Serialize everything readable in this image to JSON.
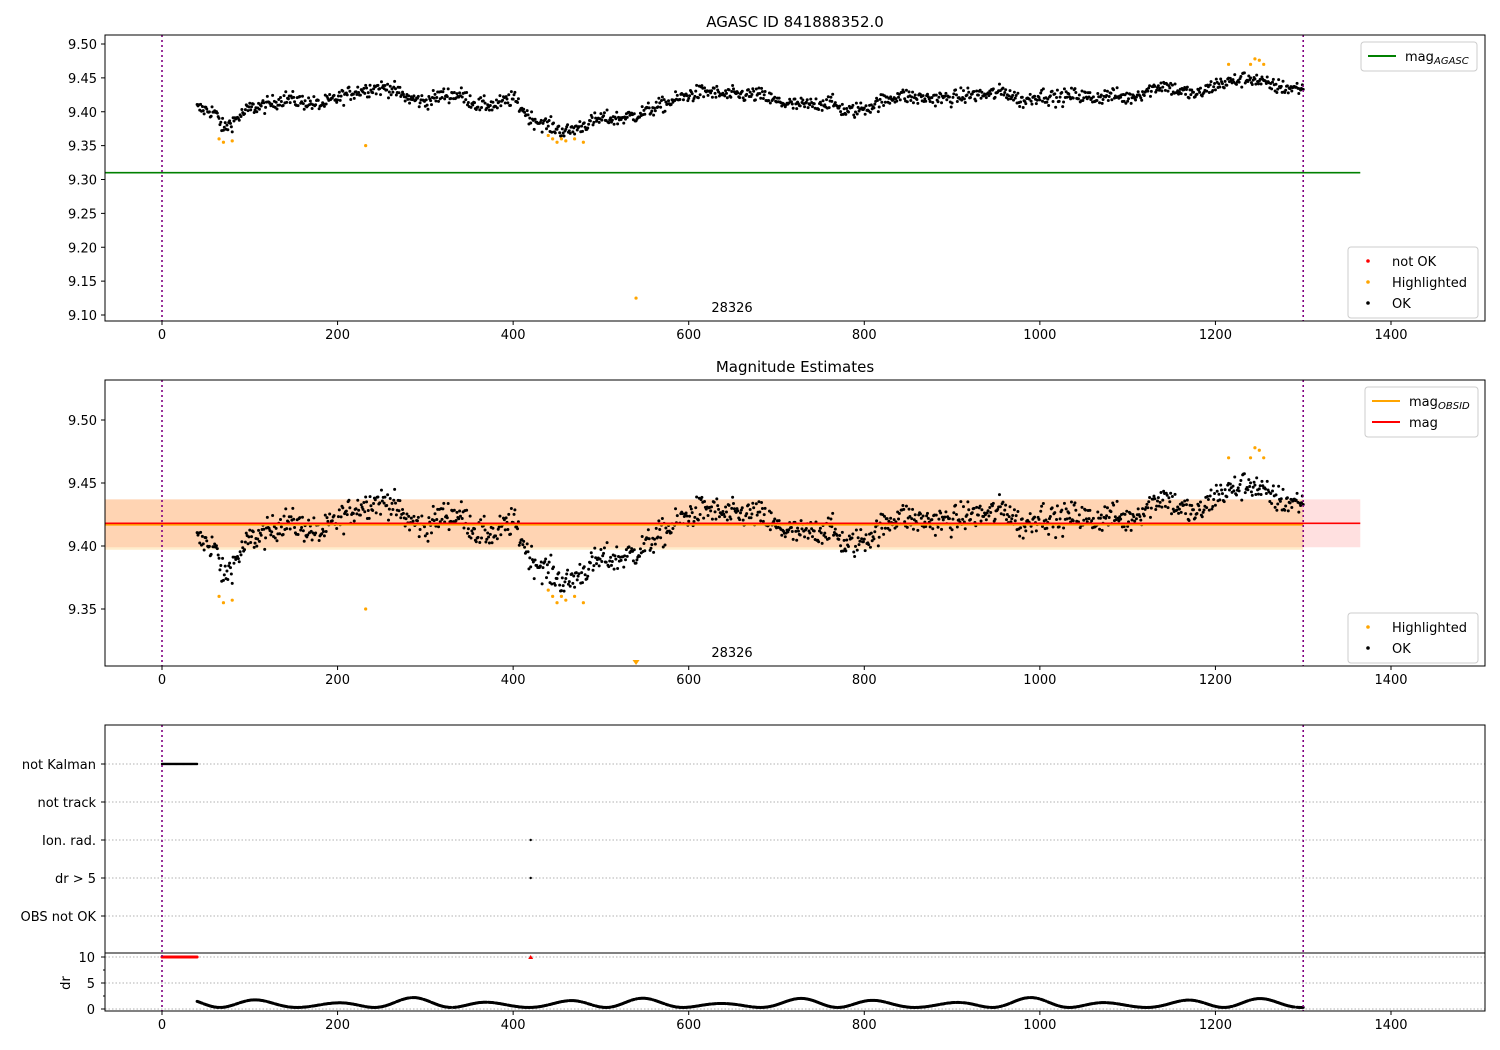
{
  "chart_data": [
    {
      "type": "scatter",
      "title": "AGASC ID 841888352.0",
      "xlim": [
        -65,
        1505
      ],
      "ylim": [
        9.092,
        9.51
      ],
      "xticks": [
        "0",
        "200",
        "400",
        "600",
        "800",
        "1000",
        "1200",
        "1400"
      ],
      "yticks": [
        "9.10",
        "9.15",
        "9.20",
        "9.25",
        "9.30",
        "9.35",
        "9.40",
        "9.45",
        "9.50"
      ],
      "annotation": "28326",
      "vlines": [
        0,
        1300
      ],
      "hline": {
        "name": "mag_AGASC",
        "value": 9.31,
        "color": "#008000",
        "xmax": 1365
      },
      "legend_top": [
        {
          "label": "mag",
          "sub": "AGASC",
          "color": "#008000"
        }
      ],
      "legend_bottom": [
        {
          "label": "not OK",
          "color": "#ff0000"
        },
        {
          "label": "Highlighted",
          "color": "#ffa500"
        },
        {
          "label": "OK",
          "color": "#000000"
        }
      ]
    },
    {
      "type": "scatter",
      "title": "Magnitude Estimates",
      "xlim": [
        -65,
        1505
      ],
      "ylim": [
        9.305,
        9.535
      ],
      "xticks": [
        "0",
        "200",
        "400",
        "600",
        "800",
        "1000",
        "1200",
        "1400"
      ],
      "yticks": [
        "9.35",
        "9.40",
        "9.45",
        "9.50"
      ],
      "annotation": "28326",
      "mag_obsid": {
        "value": 9.417,
        "band": [
          9.397,
          9.437
        ],
        "color": "#ffa500",
        "xmax": 1300
      },
      "mag": {
        "value": 9.418,
        "band": [
          9.399,
          9.437
        ],
        "color": "#ff0000",
        "xmax": 1365
      },
      "legend_top": [
        {
          "label": "mag",
          "sub": "OBSID",
          "color": "#ffa500"
        },
        {
          "label": "mag",
          "sub": "",
          "color": "#ff0000"
        }
      ],
      "legend_bottom": [
        {
          "label": "Highlighted",
          "color": "#ffa500"
        },
        {
          "label": "OK",
          "color": "#000000"
        }
      ]
    },
    {
      "type": "scatter",
      "title": "",
      "categories": [
        "not Kalman",
        "not track",
        "Ion. rad.",
        "dr > 5",
        "OBS not OK"
      ],
      "flags": [
        {
          "category": "not Kalman",
          "x_range": [
            0,
            40
          ]
        },
        {
          "category": "Ion. rad.",
          "x": [
            420
          ]
        },
        {
          "category": "dr > 5",
          "x": [
            420
          ]
        }
      ],
      "dr_ylabel": "dr",
      "dr_yticks": [
        "0",
        "5",
        "10"
      ],
      "dr_clipped": {
        "value": 10,
        "x_range": [
          0,
          40
        ],
        "x": [
          420
        ],
        "color": "#ff0000"
      },
      "dr_range": [
        0.3,
        2.2
      ],
      "xticks": [
        "0",
        "200",
        "400",
        "600",
        "800",
        "1000",
        "1200",
        "1400"
      ]
    }
  ],
  "series": {
    "ok_trend": {
      "x": [
        40,
        60,
        70,
        80,
        100,
        120,
        140,
        160,
        180,
        200,
        220,
        240,
        260,
        280,
        300,
        320,
        340,
        360,
        380,
        400,
        420,
        440,
        460,
        480,
        500,
        520,
        540,
        560,
        580,
        600,
        620,
        640,
        660,
        680,
        700,
        720,
        740,
        760,
        780,
        800,
        820,
        840,
        860,
        880,
        900,
        920,
        940,
        960,
        980,
        1000,
        1020,
        1040,
        1060,
        1080,
        1100,
        1120,
        1140,
        1160,
        1180,
        1200,
        1220,
        1240,
        1260,
        1280,
        1300
      ],
      "mag": [
        9.405,
        9.4,
        9.375,
        9.385,
        9.405,
        9.41,
        9.42,
        9.415,
        9.41,
        9.42,
        9.43,
        9.435,
        9.435,
        9.42,
        9.415,
        9.425,
        9.425,
        9.41,
        9.41,
        9.42,
        9.39,
        9.38,
        9.37,
        9.38,
        9.39,
        9.39,
        9.395,
        9.405,
        9.415,
        9.425,
        9.43,
        9.425,
        9.425,
        9.425,
        9.415,
        9.41,
        9.41,
        9.415,
        9.4,
        9.405,
        9.415,
        9.425,
        9.42,
        9.42,
        9.42,
        9.425,
        9.425,
        9.43,
        9.415,
        9.425,
        9.42,
        9.425,
        9.42,
        9.425,
        9.42,
        9.43,
        9.44,
        9.43,
        9.425,
        9.44,
        9.445,
        9.45,
        9.44,
        9.435,
        9.435
      ],
      "noise_sd": 0.011
    },
    "highlighted": {
      "x": [
        65,
        70,
        80,
        232,
        440,
        445,
        450,
        455,
        460,
        470,
        480,
        1215,
        1240,
        1245,
        1250,
        1255,
        540
      ],
      "mag": [
        9.36,
        9.355,
        9.357,
        9.35,
        9.365,
        9.36,
        9.355,
        9.36,
        9.357,
        9.36,
        9.355,
        9.47,
        9.47,
        9.478,
        9.476,
        9.47,
        9.125
      ]
    }
  }
}
